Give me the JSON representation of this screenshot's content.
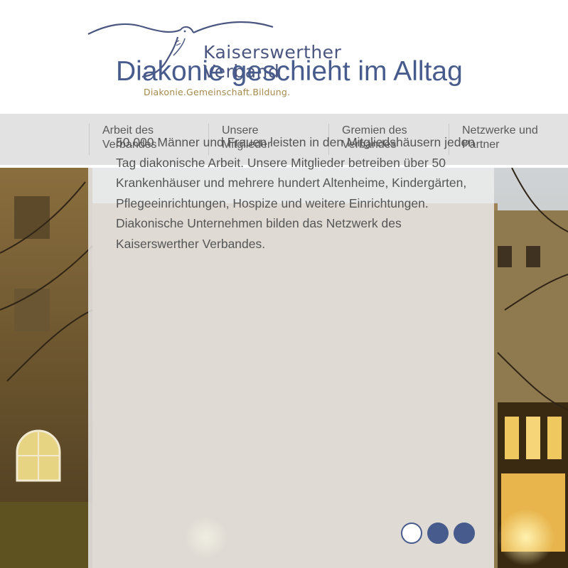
{
  "logo": {
    "name_line1": "Kaiserswerther",
    "name_line2": "Verband",
    "tagline": "Diakonie.Gemeinschaft.Bildung.",
    "icon": "dove-icon"
  },
  "nav": {
    "items": [
      {
        "line1": "Arbeit des",
        "line2": "Verbandes"
      },
      {
        "line1": "Unsere",
        "line2": "Mitglieder"
      },
      {
        "line1": "Gremien des",
        "line2": "Verbandes"
      },
      {
        "line1": "Netzwerke und",
        "line2": "Partner"
      }
    ]
  },
  "hero": {
    "title": "Diakonie geschieht im Alltag",
    "paragraph1": "50.000 Männer und Frauen leisten in den Mitgliedshäusern jeden Tag diakonische Arbeit. Unsere Mitglieder betreiben über 50 Krankenhäuser und mehrere hundert Altenheime, Kindergärten, Pflegeeinrichtungen, Hospize und weitere Einrichtungen.",
    "paragraph2": "Diakonische Unternehmen bilden das Netzwerk des Kaiserswerther Verbandes."
  },
  "carousel": {
    "slide_count": 3,
    "active_index": 0
  },
  "colors": {
    "brand_blue": "#475b8c",
    "logo_gold": "#a48a4e",
    "nav_bg": "#e2e2e2",
    "nav_text": "#5a5a5a"
  }
}
